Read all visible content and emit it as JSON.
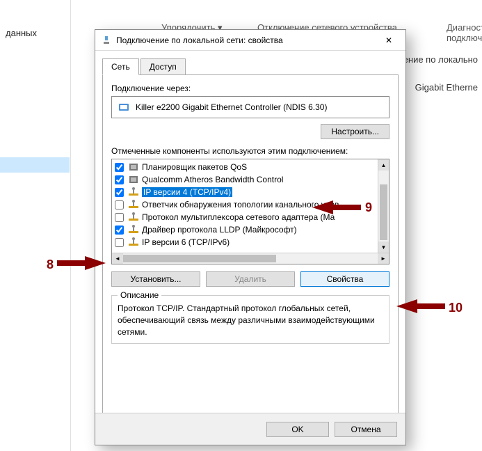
{
  "background": {
    "left_text": "данных",
    "toolbar_text1": "Упорядочить ▾",
    "toolbar_text2": "Отключение сетевого устройства",
    "toolbar_text3": "Диагностика подключе",
    "info_line1": "ение по локально",
    "info_line2": "Gigabit Etherne"
  },
  "dialog": {
    "title": "Подключение по локальной сети: свойства",
    "tabs": {
      "network": "Сеть",
      "access": "Доступ"
    },
    "connect_via_label": "Подключение через:",
    "adapter_name": "Killer e2200 Gigabit Ethernet Controller (NDIS 6.30)",
    "configure_btn": "Настроить...",
    "components_label": "Отмеченные компоненты используются этим подключением:",
    "items": [
      {
        "checked": true,
        "label": "Планировщик пакетов QoS"
      },
      {
        "checked": true,
        "label": "Qualcomm Atheros Bandwidth Control"
      },
      {
        "checked": true,
        "label": "IP версии 4 (TCP/IPv4)"
      },
      {
        "checked": false,
        "label": "Ответчик обнаружения топологии канального уров"
      },
      {
        "checked": false,
        "label": "Протокол мультиплексора сетевого адаптера (Ма"
      },
      {
        "checked": true,
        "label": "Драйвер протокола LLDP (Майкрософт)"
      },
      {
        "checked": false,
        "label": "IP версии 6 (TCP/IPv6)"
      }
    ],
    "install_btn": "Установить...",
    "delete_btn": "Удалить",
    "props_btn": "Свойства",
    "desc_legend": "Описание",
    "desc_text": "Протокол TCP/IP. Стандартный протокол глобальных сетей, обеспечивающий связь между различными взаимодействующими сетями.",
    "ok_btn": "OK",
    "cancel_btn": "Отмена"
  },
  "annotations": {
    "a8": "8",
    "a9": "9",
    "a10": "10"
  }
}
